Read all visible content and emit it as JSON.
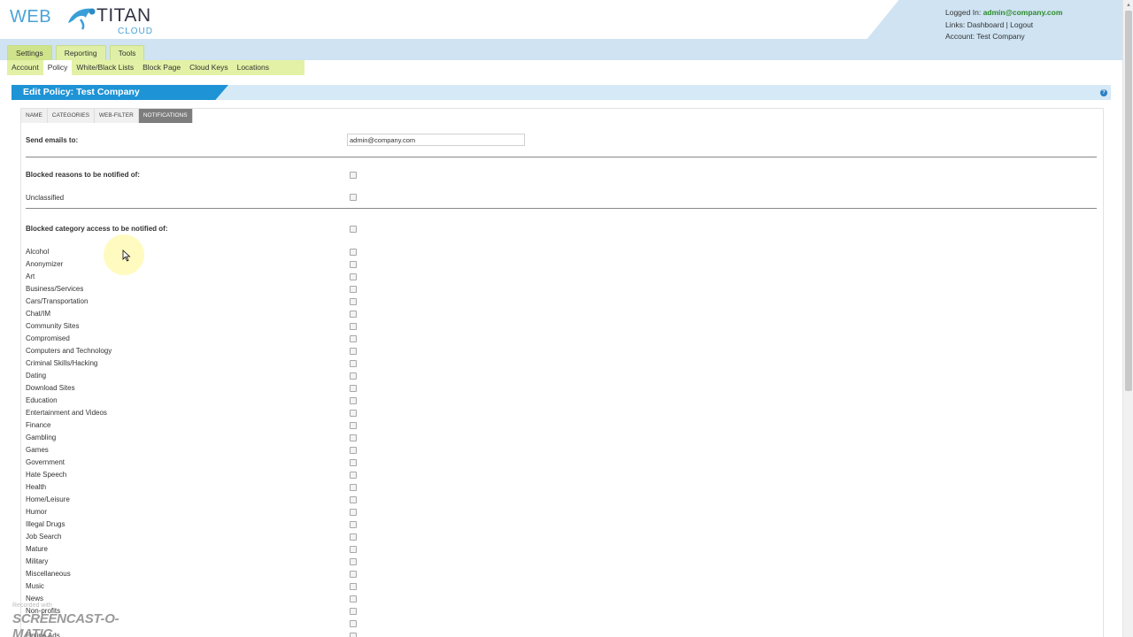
{
  "logo": {
    "web": "WEB",
    "titan": "TITAN",
    "cloud": "CLOUD"
  },
  "user": {
    "logged_in_label": "Logged In:",
    "email": "admin@company.com",
    "links_label": "Links:",
    "dashboard": "Dashboard",
    "separator": "|",
    "logout": "Logout",
    "account_label": "Account:",
    "account": "Test Company"
  },
  "top_tabs": [
    {
      "label": "Settings",
      "active": true
    },
    {
      "label": "Reporting",
      "active": false
    },
    {
      "label": "Tools",
      "active": false
    }
  ],
  "subnav": [
    {
      "label": "Account",
      "active": false
    },
    {
      "label": "Policy",
      "active": true
    },
    {
      "label": "White/Black Lists",
      "active": false
    },
    {
      "label": "Block Page",
      "active": false
    },
    {
      "label": "Cloud Keys",
      "active": false
    },
    {
      "label": "Locations",
      "active": false
    }
  ],
  "panel": {
    "title": "Edit Policy: Test Company",
    "help_glyph": "?"
  },
  "form_tabs": [
    {
      "label": "NAME",
      "active": false
    },
    {
      "label": "CATEGORIES",
      "active": false
    },
    {
      "label": "WEB-FILTER",
      "active": false
    },
    {
      "label": "NOTIFICATIONS",
      "active": true
    }
  ],
  "form": {
    "send_emails_label": "Send emails to:",
    "send_emails_value": "admin@company.com",
    "blocked_reasons_label": "Blocked reasons to be notified of:",
    "unclassified_label": "Unclassified",
    "blocked_category_label": "Blocked category access to be notified of:"
  },
  "categories": [
    "Alcohol",
    "Anonymizer",
    "Art",
    "Business/Services",
    "Cars/Transportation",
    "Chat/IM",
    "Community Sites",
    "Compromised",
    "Computers and Technology",
    "Criminal Skills/Hacking",
    "Dating",
    "Download Sites",
    "Education",
    "Entertainment and Videos",
    "Finance",
    "Gambling",
    "Games",
    "Government",
    "Hate Speech",
    "Health",
    "Home/Leisure",
    "Humor",
    "Illegal Drugs",
    "Job Search",
    "Mature",
    "Military",
    "Miscellaneous",
    "Music",
    "News",
    "Non-profits",
    "",
    "Online Ads"
  ],
  "watermark": {
    "small": "Recorded with",
    "big": "SCREENCAST-O-MATIC"
  },
  "colors": {
    "accent": "#1e93d6",
    "nav_green": "#e2f1a5",
    "header_blue": "#cfe3f2"
  }
}
